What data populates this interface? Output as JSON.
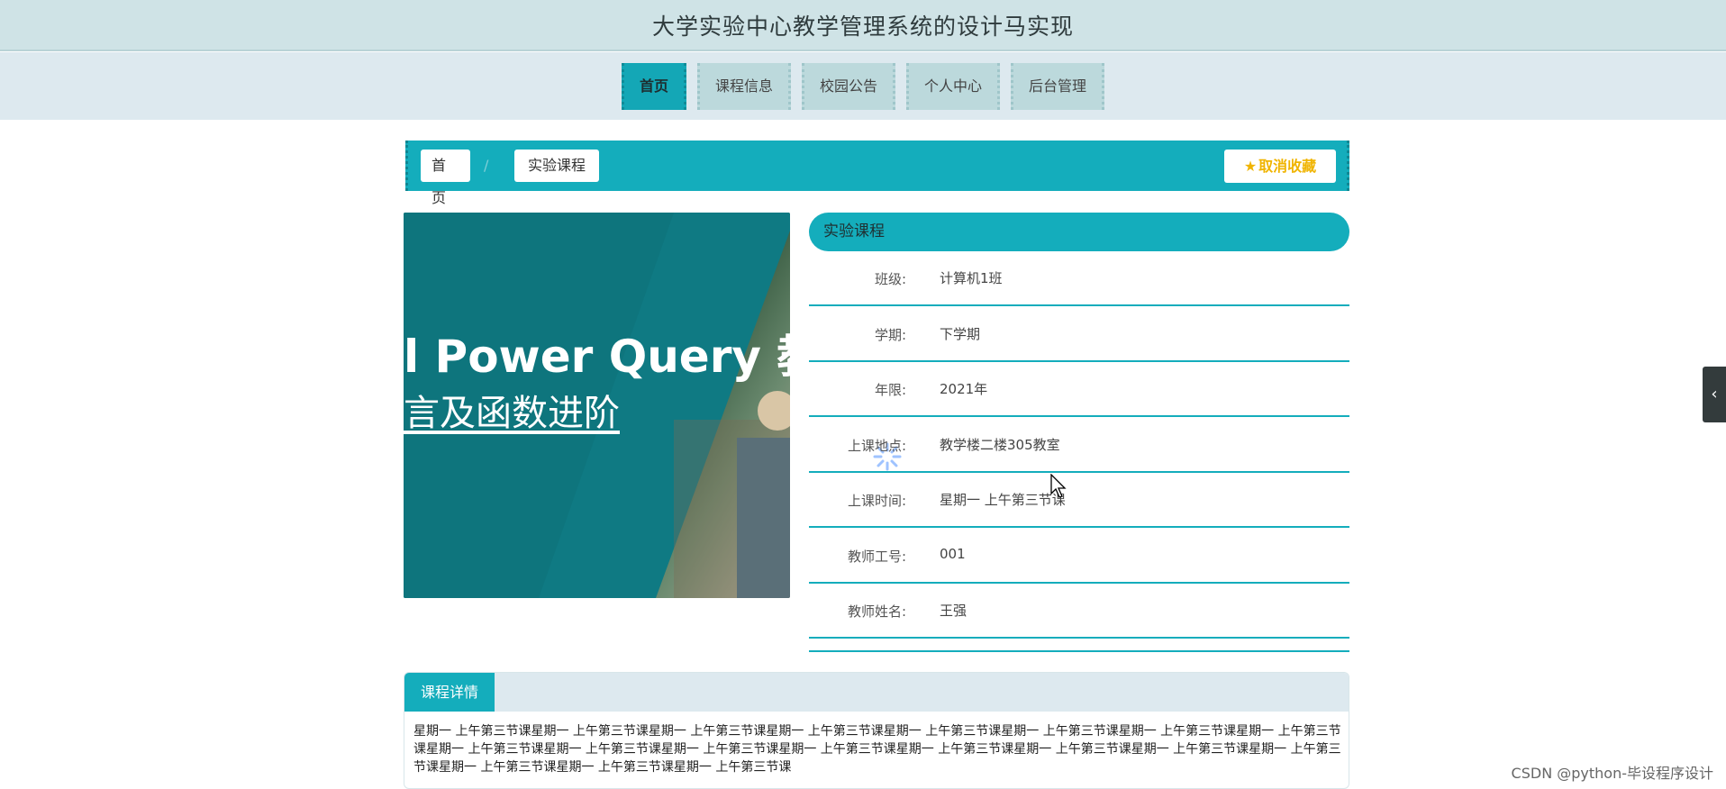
{
  "header": {
    "title": "大学实验中心教学管理系统的设计马实现"
  },
  "nav": {
    "items": [
      {
        "label": "首页",
        "active": true
      },
      {
        "label": "课程信息",
        "active": false
      },
      {
        "label": "校园公告",
        "active": false
      },
      {
        "label": "个人中心",
        "active": false
      },
      {
        "label": "后台管理",
        "active": false
      }
    ]
  },
  "breadcrumb": {
    "home": "首页",
    "separator": "/",
    "current": "实验课程"
  },
  "favorite": {
    "label": "取消收藏",
    "icon": "star-icon"
  },
  "image": {
    "line1": "l Power Query 教",
    "line2": "言及函数进阶"
  },
  "info": {
    "header": "实验课程",
    "rows": [
      {
        "label": "班级:",
        "value": "计算机1班"
      },
      {
        "label": "学期:",
        "value": "下学期"
      },
      {
        "label": "年限:",
        "value": "2021年"
      },
      {
        "label": "上课地点:",
        "value": "教学楼二楼305教室"
      },
      {
        "label": "上课时间:",
        "value": "星期一 上午第三节课"
      },
      {
        "label": "教师工号:",
        "value": "001"
      },
      {
        "label": "教师姓名:",
        "value": "王强"
      }
    ]
  },
  "detail": {
    "tab": "课程详情",
    "text": "星期一 上午第三节课星期一 上午第三节课星期一 上午第三节课星期一 上午第三节课星期一 上午第三节课星期一 上午第三节课星期一 上午第三节课星期一 上午第三节课星期一 上午第三节课星期一 上午第三节课星期一 上午第三节课星期一 上午第三节课星期一 上午第三节课星期一 上午第三节课星期一 上午第三节课星期一 上午第三节课星期一 上午第三节课星期一 上午第三节课星期一 上午第三节课"
  },
  "side_handle": {
    "icon": "chevron-left-icon",
    "glyph": "‹"
  },
  "watermark": "CSDN @python-毕设程序设计",
  "colors": {
    "accent": "#14adbc",
    "header_bg": "#cfe3e6",
    "nav_bg": "#dde9ef",
    "favorite": "#f0b400"
  }
}
